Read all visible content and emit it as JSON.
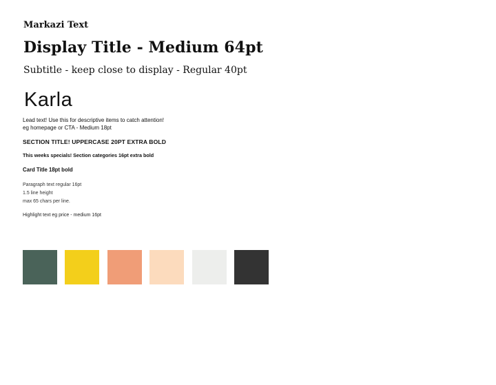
{
  "markazi": {
    "font_name": "Markazi Text",
    "display_title": "Display Title - Medium 64pt",
    "subtitle": "Subtitle - keep close to display - Regular 40pt"
  },
  "karla": {
    "font_name": "Karla",
    "lead_text_line1": "Lead text! Use this for descriptive items to catch attention!",
    "lead_text_line2": "eg homepage or CTA - Medium 18pt",
    "section_title": "SECTION TITLE! UPPERCASE 20PT EXTRA BOLD",
    "section_categories": "This weeks specials! Section categories 16pt extra bold",
    "card_title": "Card Title 18pt bold",
    "paragraph_lines": [
      "Paragraph text regular 16pt",
      "1.5 line height",
      "max 65 chars per line."
    ],
    "highlight_text": "Highlight text eg price - medium 16pt"
  },
  "palette": [
    {
      "color": "#4a6359"
    },
    {
      "color": "#f3cf1b"
    },
    {
      "color": "#f09d77"
    },
    {
      "color": "#fcdbbd"
    },
    {
      "color": "#edeeec"
    },
    {
      "color": "#333333"
    }
  ]
}
